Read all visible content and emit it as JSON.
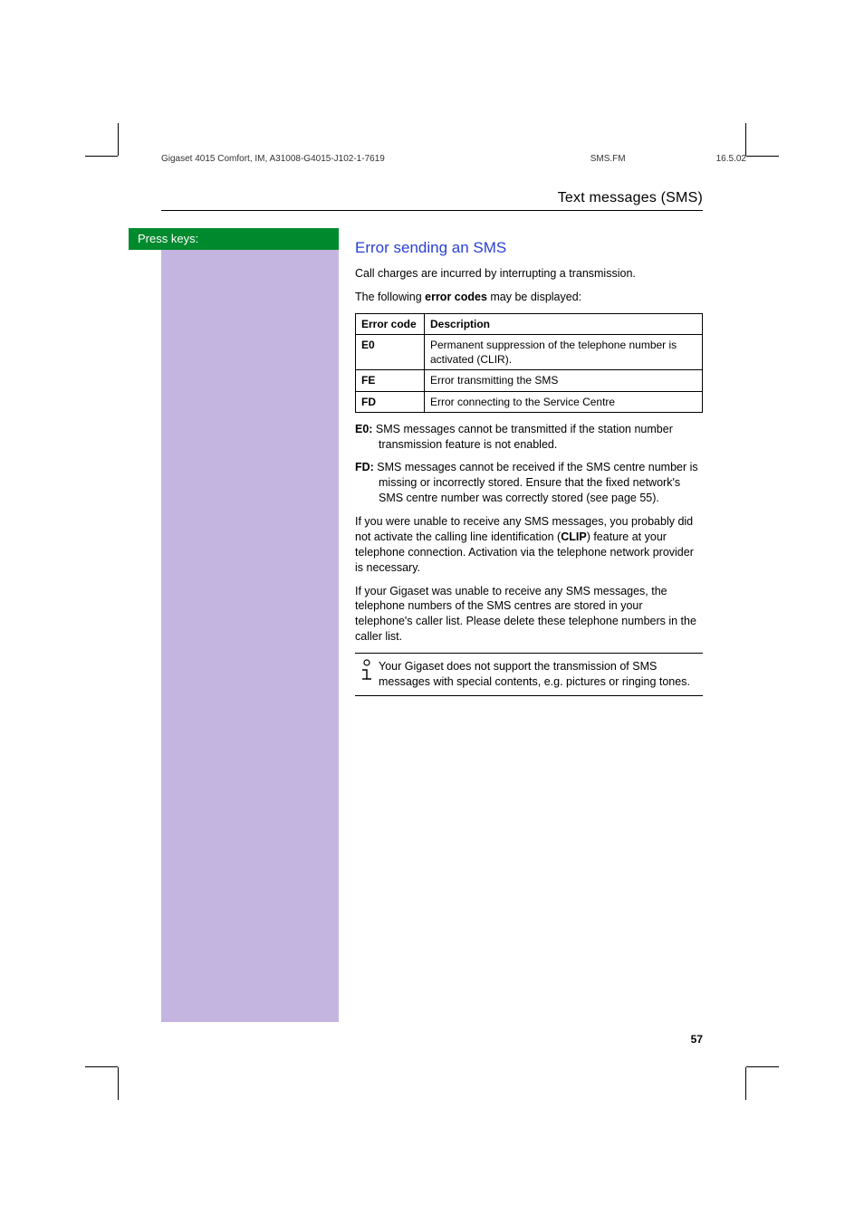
{
  "meta": {
    "doc_id": "Gigaset 4015 Comfort, IM, A31008-G4015-J102-1-7619",
    "file": "SMS.FM",
    "date": "16.5.02"
  },
  "running_head": "Text messages (SMS)",
  "sidebar_label": "Press keys:",
  "heading": "Error sending an SMS",
  "intro1": "Call charges are incurred by interrupting a transmission.",
  "intro2a": "The following ",
  "intro2b": "error codes",
  "intro2c": " may be displayed:",
  "table": {
    "head": {
      "c1": "Error code",
      "c2": "Description"
    },
    "rows": [
      {
        "code": "E0",
        "desc": "Permanent suppression of the telephone number is activated (CLIR)."
      },
      {
        "code": "FE",
        "desc": "Error transmitting the SMS"
      },
      {
        "code": "FD",
        "desc": "Error connecting to the Service Centre"
      }
    ]
  },
  "defs": {
    "e0_label": "E0:",
    "e0_text": " SMS messages cannot be transmitted if the station number transmission feature is not enabled.",
    "fd_label": "FD:",
    "fd_text": " SMS messages cannot be received if the SMS centre number is missing or incorrectly stored. Ensure that the fixed network's  SMS centre number was correctly stored (see  page 55)."
  },
  "para1a": "If you were unable to receive any SMS messages, you probably did not activate the calling line identification (",
  "para1b": "CLIP",
  "para1c": ") feature at your telephone connection. Activation via the telephone network provider is necessary.",
  "para2": "If your Gigaset was unable to receive any SMS messages, the telephone numbers of the SMS centres are stored in your telephone's caller list. Please delete these telephone numbers in the caller list.",
  "note": "Your Gigaset does not support the transmission of SMS messages with special contents, e.g. pictures or ringing tones.",
  "page_number": "57"
}
